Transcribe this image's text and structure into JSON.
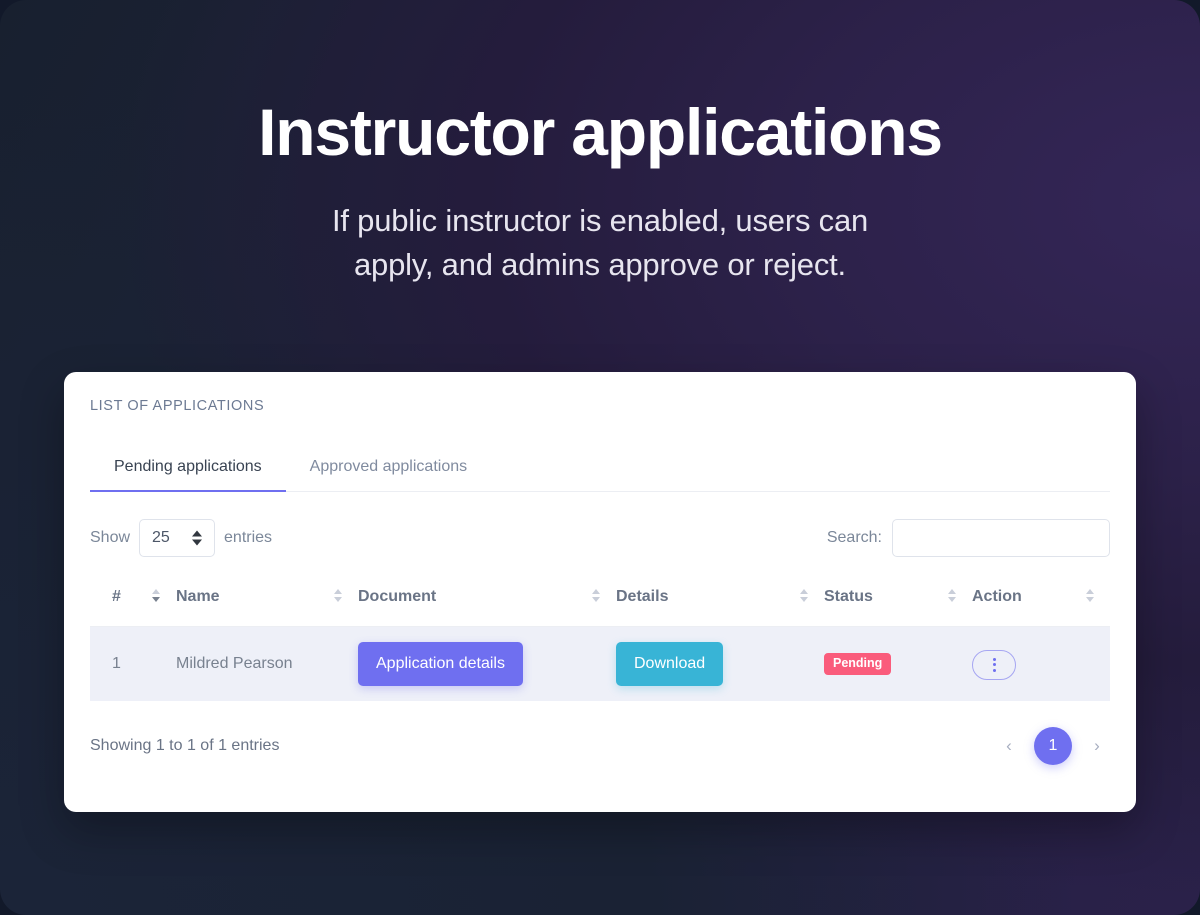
{
  "hero": {
    "title": "Instructor applications",
    "subtitle_line1": "If public instructor is enabled, users can",
    "subtitle_line2": "apply, and admins approve or reject."
  },
  "card": {
    "title": "LIST OF APPLICATIONS",
    "tabs": [
      {
        "label": "Pending applications",
        "active": true
      },
      {
        "label": "Approved applications",
        "active": false
      }
    ],
    "controls": {
      "show_label": "Show",
      "entries_label": "entries",
      "page_length": "25",
      "search_label": "Search:",
      "search_value": "",
      "search_placeholder": ""
    },
    "columns": [
      {
        "label": "#"
      },
      {
        "label": "Name"
      },
      {
        "label": "Document"
      },
      {
        "label": "Details"
      },
      {
        "label": "Status"
      },
      {
        "label": "Action"
      }
    ],
    "rows": [
      {
        "index": "1",
        "name": "Mildred Pearson",
        "document_label": "Application details",
        "details_label": "Download",
        "status": "Pending",
        "action_icon": "kebab-menu-icon"
      }
    ],
    "footer": {
      "info": "Showing 1 to 1 of 1 entries",
      "prev_label": "‹",
      "next_label": "›",
      "current_page": "1"
    }
  },
  "colors": {
    "accent_purple": "#6f6ff0",
    "accent_cyan": "#38b4d6",
    "status_pink": "#fa5c7c",
    "row_bg": "#eef0f8"
  }
}
